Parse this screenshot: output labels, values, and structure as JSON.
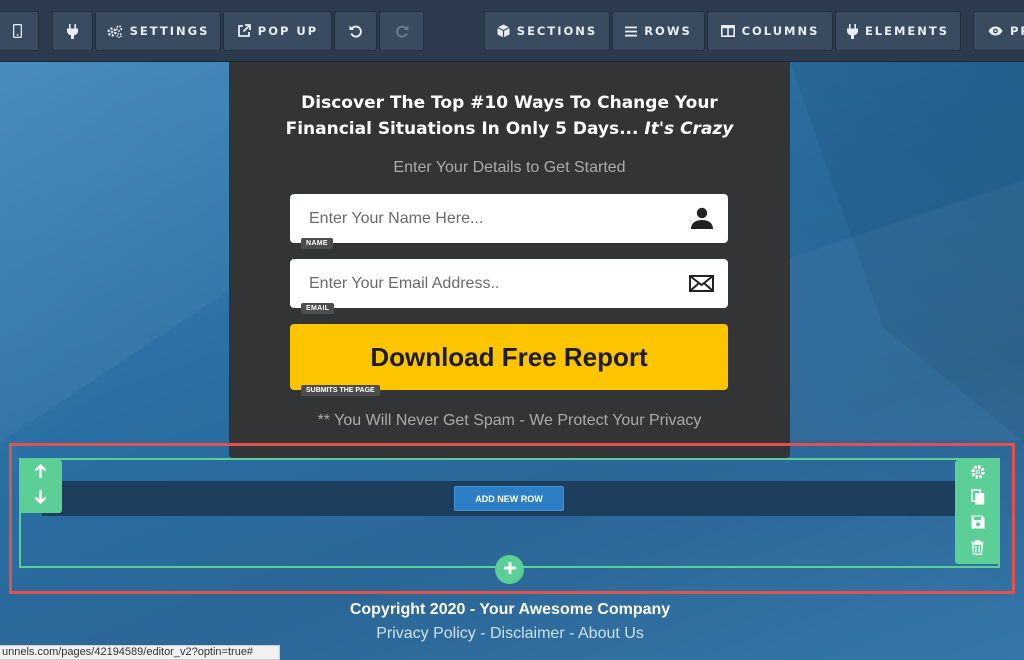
{
  "toolbar": {
    "settings_label": "SETTINGS",
    "popup_label": "POP UP",
    "sections_label": "SECTIONS",
    "rows_label": "ROWS",
    "columns_label": "COLUMNS",
    "elements_label": "ELEMENTS",
    "preview_label": "PR",
    "icons": [
      "mobile-icon",
      "plug-icon",
      "gears-icon",
      "external-link-icon",
      "undo-icon",
      "redo-icon",
      "cube-icon",
      "bars-icon",
      "columns-icon",
      "plug-icon",
      "eye-icon"
    ]
  },
  "optin": {
    "headline_line1": "Discover The Top #10 Ways To Change Your",
    "headline_line2": "Financial Situations In Only 5 Days... ",
    "headline_emphasis": "It's Crazy",
    "subheadline": "Enter Your Details to Get Started",
    "name_field": {
      "placeholder": "Enter Your Name Here...",
      "tag": "NAME",
      "icon": "user-icon"
    },
    "email_field": {
      "placeholder": "Enter Your Email Address..",
      "tag": "EMAIL",
      "icon": "envelope-icon"
    },
    "cta_label": "Download Free Report",
    "cta_tag": "SUBMITS THE PAGE",
    "privacy_text": "** You Will Never Get Spam - We Protect Your Privacy"
  },
  "row_editor": {
    "add_row_label": "ADD NEW ROW",
    "accent_color": "#5ccf96",
    "highlight_color": "#e0534d"
  },
  "footer": {
    "copyright": "Copyright 2020 - Your Awesome Company",
    "links": [
      "Privacy Policy",
      "Disclaimer",
      "About Us"
    ],
    "separator": " - "
  },
  "status_url": "unnels.com/pages/42194589/editor_v2?optin=true#"
}
